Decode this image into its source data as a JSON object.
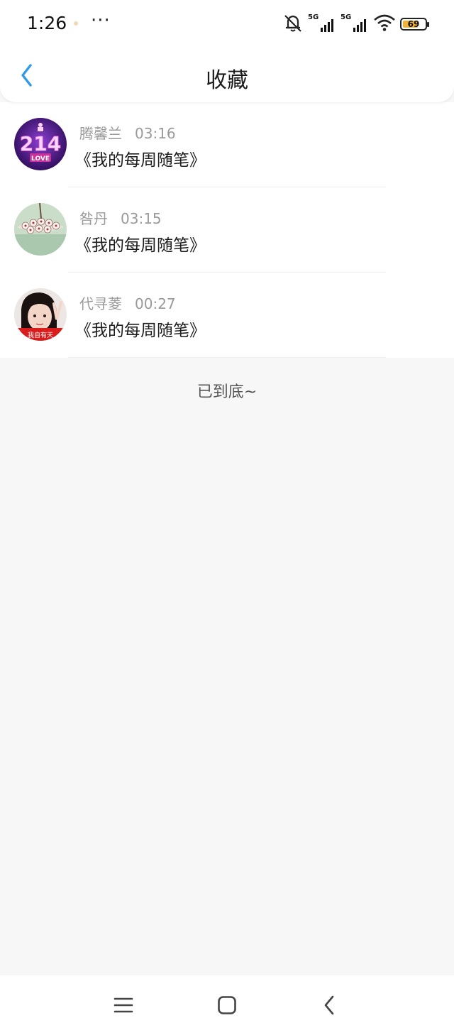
{
  "status_bar": {
    "time": "1:26",
    "more": "···",
    "signal_1_label": "5G",
    "signal_2_label": "5G",
    "battery": "69",
    "battery_level": 0.69,
    "icons": [
      "silent-bell-icon",
      "signal-5g-icon",
      "signal-5g-icon",
      "wifi-icon",
      "battery-icon"
    ]
  },
  "header": {
    "title": "收藏",
    "back_icon": "chevron-left-icon"
  },
  "favorites": [
    {
      "name": "腾馨兰",
      "time": "03:16",
      "title": "《我的每周随笔》"
    },
    {
      "name": "咎丹",
      "time": "03:15",
      "title": "《我的每周随笔》"
    },
    {
      "name": "代寻菱",
      "time": "00:27",
      "title": "《我的每周随笔》"
    }
  ],
  "avatar_1_text": {
    "number": "214",
    "love": "LOVE"
  },
  "avatar_3_text": "我自有天",
  "end_text": "已到底~",
  "nav": {
    "icons": [
      "menu-icon",
      "home-square-icon",
      "back-icon"
    ]
  },
  "colors": {
    "accent": "#2f9be8",
    "background": "#f8f7f8",
    "battery": "#f2b23a"
  }
}
